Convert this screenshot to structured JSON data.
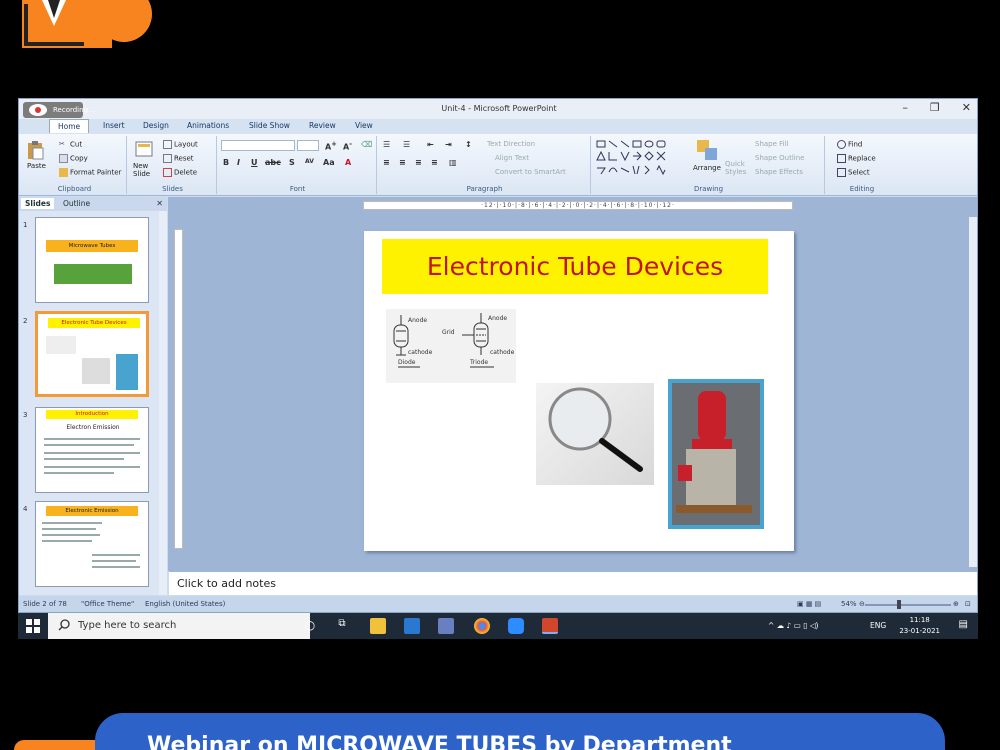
{
  "window": {
    "title": "Unit-4 - Microsoft PowerPoint",
    "recording_label": "Recording...",
    "controls": [
      "–",
      "❐",
      "✕"
    ]
  },
  "ribbon": {
    "tabs": [
      "Home",
      "Insert",
      "Design",
      "Animations",
      "Slide Show",
      "Review",
      "View"
    ],
    "active_tab": "Home",
    "clipboard": {
      "paste": "Paste",
      "cut": "Cut",
      "copy": "Copy",
      "format_painter": "Format Painter",
      "label": "Clipboard"
    },
    "slides": {
      "new_slide": "New Slide",
      "layout": "Layout",
      "reset": "Reset",
      "delete": "Delete",
      "label": "Slides"
    },
    "font": {
      "label": "Font"
    },
    "paragraph": {
      "text_direction": "Text Direction",
      "align_text": "Align Text",
      "convert": "Convert to SmartArt",
      "label": "Paragraph"
    },
    "drawing": {
      "arrange": "Arrange",
      "quick_styles": "Quick Styles",
      "shape_fill": "Shape Fill",
      "shape_outline": "Shape Outline",
      "shape_effects": "Shape Effects",
      "label": "Drawing"
    },
    "editing": {
      "find": "Find",
      "replace": "Replace",
      "select": "Select",
      "label": "Editing"
    }
  },
  "left_pane": {
    "tabs": [
      "Slides",
      "Outline"
    ],
    "thumbnails": [
      {
        "number": "1",
        "title": "Microwave Tubes"
      },
      {
        "number": "2",
        "title": "Electronic Tube Devices"
      },
      {
        "number": "3",
        "title": "Introduction",
        "subtitle": "Electron Emission"
      },
      {
        "number": "4",
        "title": "Electronic Emission"
      }
    ]
  },
  "slide": {
    "title": "Electronic Tube Devices",
    "diagram_labels": {
      "anode1": "Anode",
      "cathode1": "cathode",
      "diode": "Diode",
      "grid": "Grid",
      "anode2": "Anode",
      "cathode2": "cathode",
      "triode": "Triode"
    }
  },
  "notes_placeholder": "Click to add notes",
  "status": {
    "slide_info": "Slide 2 of 78",
    "theme": "\"Office Theme\"",
    "language": "English (United States)",
    "zoom": "54%"
  },
  "taskbar": {
    "search_placeholder": "Type here to search",
    "language": "ENG",
    "time": "11:18",
    "date": "23-01-2021"
  },
  "banner": {
    "text": "Webinar on MICROWAVE TUBES by Department"
  },
  "colors": {
    "slide_title_bg": "#fff200",
    "slide_title_fg": "#c0141b",
    "banner": "#2d62c8",
    "accent_orange": "#f7841f",
    "taskbar": "#1f2a38"
  }
}
